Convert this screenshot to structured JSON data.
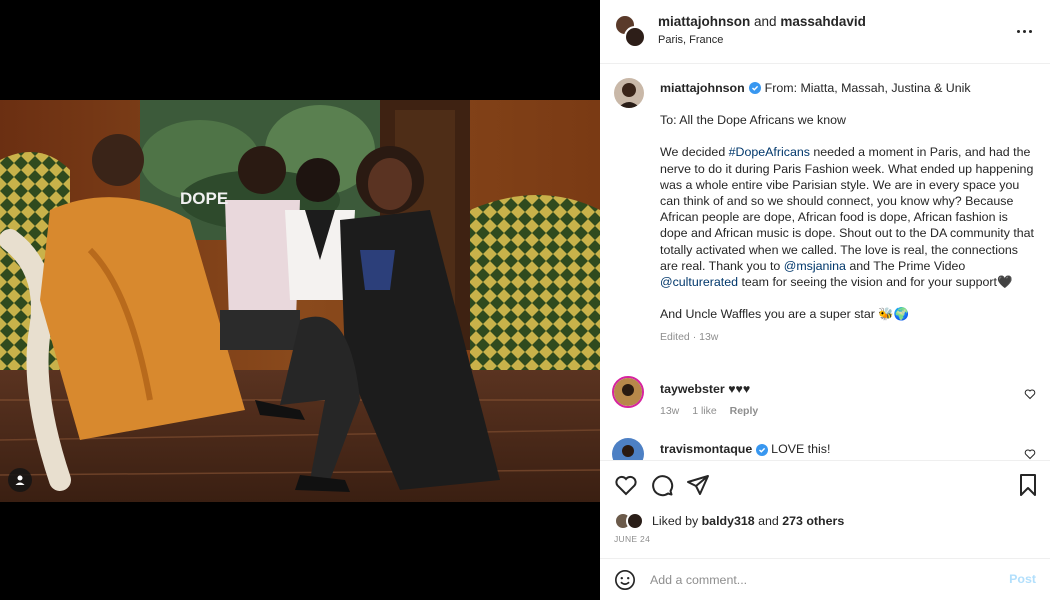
{
  "post": {
    "photo_overlay_text": "DOPE"
  },
  "header": {
    "user1": "miattajohnson",
    "conj": "and",
    "user2": "massahdavid",
    "location": "Paris, France"
  },
  "caption": {
    "username": "miattajohnson",
    "from_line": "From: Miatta, Massah, Justina & Unik",
    "to_line": "To: All the Dope Africans we know",
    "p1_a": "We decided ",
    "p1_tag": "#DopeAfricans",
    "p1_b": " needed a moment in Paris, and had the nerve to do it during Paris Fashion week. What ended up happening was a whole entire vibe Parisian style. We are in every space you can think of and so we should connect, you know why? Because African people are dope, African food is dope, African fashion is dope and African music is dope. Shout out to the DA community that totally activated when we called. The love is real, the connections are real. Thank you to ",
    "p1_mention1": "@msjanina",
    "p1_c": " and The Prime Video ",
    "p1_mention2": "@culturerated",
    "p1_d": " team for seeing the vision and for your support🖤",
    "p2": "And Uncle Waffles you are a super star 🐝🌍",
    "edited": "Edited · 13w"
  },
  "comments": [
    {
      "username": "taywebster",
      "text": "♥♥♥",
      "age": "13w",
      "likes": "1 like",
      "reply": "Reply"
    },
    {
      "username": "travismontaque",
      "text": "LOVE this!"
    }
  ],
  "likes": {
    "prefix": "Liked by",
    "user": "baldy318",
    "mid": "and",
    "others": "273 others"
  },
  "date": "JUNE 24",
  "add_comment": {
    "placeholder": "Add a comment...",
    "post_label": "Post"
  },
  "icons": {
    "like": "heart-icon",
    "comment": "comment-icon",
    "share": "share-icon",
    "save": "bookmark-icon",
    "more": "more-icon",
    "emoji": "emoji-icon",
    "tag": "user-tag-icon",
    "verified": "verified-badge-icon"
  },
  "colors": {
    "verified": "#3897f0",
    "link": "#00376b",
    "secondary_text": "#8e8e8e",
    "post_disabled": "#b2dffc"
  }
}
